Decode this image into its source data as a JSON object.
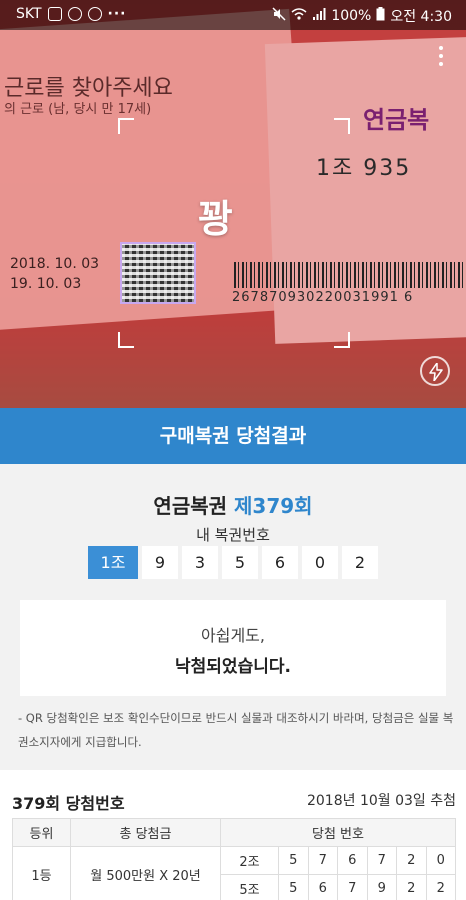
{
  "status_bar": {
    "carrier": "SKT",
    "battery": "100%",
    "time": "오전 4:30",
    "more": "···"
  },
  "camera": {
    "overlay_text": "꽝",
    "ticket_title": "근로를 찾아주세요",
    "ticket_sub": "의 근로 (남, 당시 만 17세)",
    "ticket_date1": "2018. 10. 03",
    "ticket_date2": "19. 10. 03",
    "ticket_logo": "연금복",
    "ticket_number": "1조 935",
    "barcode_number": "267870930220031991 6"
  },
  "header": {
    "title": "구매복권 당첨결과"
  },
  "result": {
    "lottery_name": "연금복권",
    "round": "제379회",
    "my_numbers_label": "내 복권번호",
    "group": "1조",
    "digits": [
      "9",
      "3",
      "5",
      "6",
      "0",
      "2"
    ],
    "message_line1": "아쉽게도,",
    "message_line2": "낙첨되었습니다.",
    "notice": "- QR 당첨확인은 보조 확인수단이므로 반드시 실물과 대조하시기 바라며, 당첨금은 실물 복권소지자에게 지급합니다."
  },
  "winning": {
    "title": "379회 당첨번호",
    "date": "2018년 10월 03일 추첨",
    "headers": [
      "등위",
      "총 당첨금",
      "당첨 번호"
    ],
    "rank": "1등",
    "prize": "월 500만원 X 20년",
    "rows": [
      {
        "group": "2조",
        "digits": [
          "5",
          "7",
          "6",
          "7",
          "2",
          "0"
        ]
      },
      {
        "group": "5조",
        "digits": [
          "5",
          "6",
          "7",
          "9",
          "2",
          "2"
        ]
      }
    ]
  },
  "colors": {
    "accent": "#2f86cc",
    "group_badge": "#3b8fd6"
  }
}
